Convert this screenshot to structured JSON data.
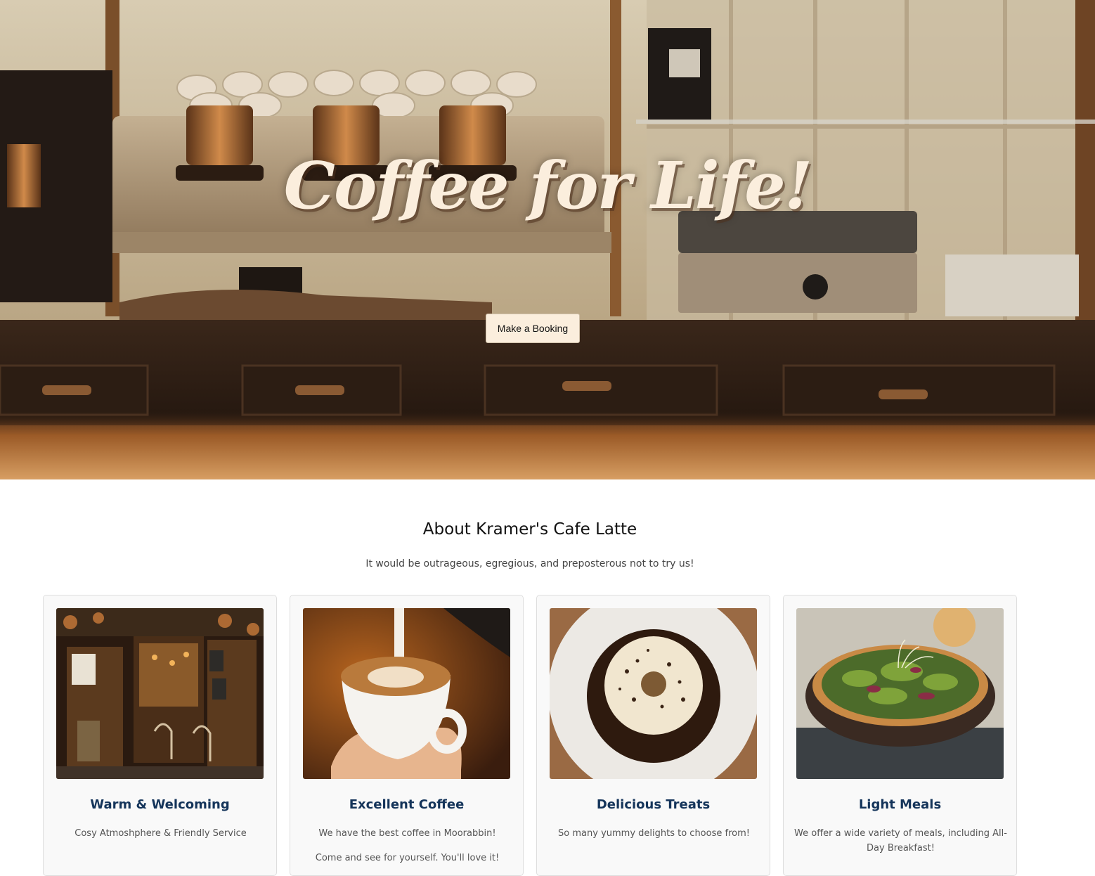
{
  "hero": {
    "title": "Coffee for Life!",
    "button_label": "Make a Booking"
  },
  "about": {
    "title": "About Kramer's Cafe Latte",
    "subtitle": "It would be outrageous, egregious, and preposterous not to try us!",
    "cards": [
      {
        "title": "Warm & Welcoming",
        "text": "Cosy Atmoshphere & Friendly Service",
        "text2": "",
        "image": "cafe-storefront"
      },
      {
        "title": "Excellent Coffee",
        "text": "We have the best coffee in Moorabbin!",
        "text2": "Come and see for yourself. You'll love it!",
        "image": "latte-art"
      },
      {
        "title": "Delicious Treats",
        "text": "So many yummy delights to choose from!",
        "text2": "",
        "image": "donut-on-plate"
      },
      {
        "title": "Light Meals",
        "text": "We offer a wide variety of meals, including All-Day Breakfast!",
        "text2": "",
        "image": "salad-bowl"
      }
    ]
  },
  "colors": {
    "hero_title": "#fbeedd",
    "button_bg": "#fbeedd",
    "card_title": "#14345a",
    "card_bg": "#f9f9f9"
  }
}
